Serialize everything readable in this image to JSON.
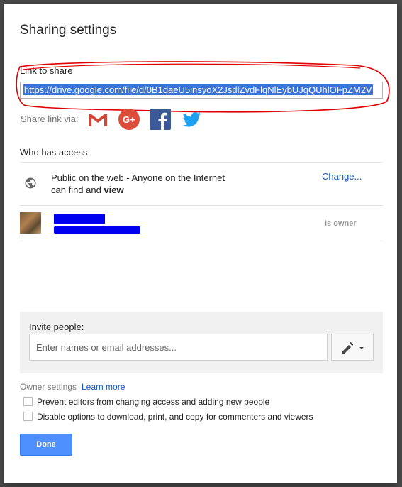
{
  "dialog": {
    "title": "Sharing settings"
  },
  "link": {
    "label": "Link to share",
    "url": "https://drive.google.com/file/d/0B1daeU5insyoX2JsdlZvdFlqNlEybUJqQUhlOFpZM2V"
  },
  "share_via": {
    "label": "Share link via:",
    "icons": [
      "gmail-icon",
      "google-plus-icon",
      "facebook-icon",
      "twitter-icon"
    ],
    "colors": {
      "gmail": "#d44638",
      "google_plus": "#dd4b39",
      "facebook": "#3b5998",
      "twitter": "#1da1f2"
    }
  },
  "access": {
    "label": "Who has access",
    "public_line1": "Public on the web - Anyone on the Internet",
    "public_line2_prefix": "can find and ",
    "public_line2_bold": "view",
    "change_label": "Change...",
    "owner_role": "Is owner"
  },
  "invite": {
    "label": "Invite people:",
    "placeholder": "Enter names or email addresses..."
  },
  "owner_settings": {
    "label": "Owner settings",
    "learn_more": "Learn more",
    "option1": "Prevent editors from changing access and adding new people",
    "option2": "Disable options to download, print, and copy for commenters and viewers"
  },
  "footer": {
    "done_label": "Done"
  },
  "colors": {
    "accent": "#4d90fe",
    "link": "#1155cc",
    "highlight_annotation": "#e00000"
  }
}
